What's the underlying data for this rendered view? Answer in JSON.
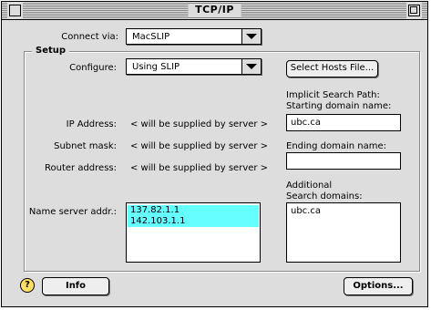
{
  "window": {
    "title": "TCP/IP"
  },
  "connect_via": {
    "label": "Connect via:",
    "value": "MacSLIP"
  },
  "setup": {
    "label": "Setup",
    "configure_label": "Configure:",
    "configure_value": "Using SLIP",
    "select_hosts_button": "Select Hosts File...",
    "ip_label": "IP Address:",
    "ip_value": "< will be supplied by server >",
    "subnet_label": "Subnet mask:",
    "subnet_value": "< will be supplied by server >",
    "router_label": "Router address:",
    "router_value": "< will be supplied by server >",
    "nameserver_label": "Name server addr.:",
    "nameservers": [
      "137.82.1.1",
      "142.103.1.1"
    ],
    "implicit_label_1": "Implicit Search Path:",
    "implicit_label_2": "Starting domain name:",
    "starting_domain": "ubc.ca",
    "ending_label": "Ending domain name:",
    "ending_domain": "",
    "additional_label_1": "Additional",
    "additional_label_2": "Search domains:",
    "additional_domains": [
      "ubc.ca"
    ]
  },
  "footer": {
    "help_icon": "?",
    "info_button": "Info",
    "options_button": "Options..."
  },
  "colors": {
    "selection": "#66ffff",
    "window_bg": "#dddddd"
  }
}
